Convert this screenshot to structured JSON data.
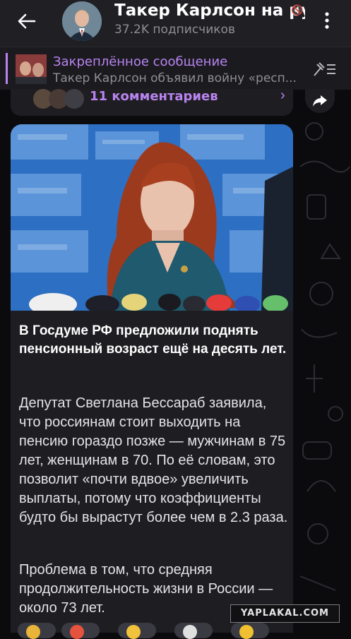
{
  "header": {
    "back_icon": "arrow-left-icon",
    "title": "Такер Карлсон на рус",
    "subtitle": "37.2K подписчиков",
    "muted_icon": "mute-icon",
    "menu_icon": "more-vertical-icon"
  },
  "pinned": {
    "title": "Закреплённое сообщение",
    "text": "Такер Карлсон объявил войну «респ...",
    "action_icon": "unpin-list-icon"
  },
  "comments": {
    "label": "11 комментариев",
    "chevron_icon": "chevron-right-icon",
    "share_icon": "share-icon"
  },
  "post": {
    "headline": "В Госдуме РФ предложили поднять пенсионный возраст ещё на десять лет.",
    "paragraph1": "Депутат Светлана Бессараб заявила, что россиянам стоит выходить на пенсию гораздо позже — мужчинам в 75 лет, женщинам в 70. По её словам, это позволит «почти вдвое» увеличить выплаты, потому что коэффициенты будто бы вырастут более чем в 2.3 раза.",
    "paragraph2": "Проблема в том, что средняя продолжительность жизни в России — около 73 лет."
  },
  "watermark": "YAPLAKAL.COM",
  "colors": {
    "accent": "#b984f0",
    "bubble": "#1e1e22",
    "header": "#1f1f24"
  }
}
